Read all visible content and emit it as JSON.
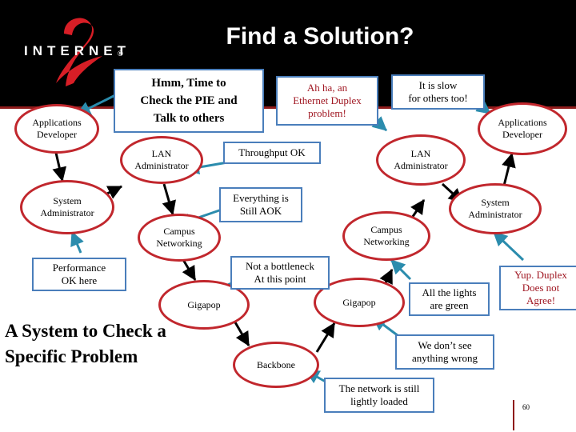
{
  "slide": {
    "title": "Find a Solution?",
    "bottom_heading": "A System to Check a Specific Problem",
    "page_number": "60",
    "logo": {
      "wordmark": "INTERNET",
      "numeral": "2",
      "registered": "®"
    },
    "colors": {
      "band": "#000000",
      "band_rule": "#8e1b1b",
      "title_text": "#ffffff",
      "node_border": "#c1272d",
      "box_border": "#4a7ebb",
      "callout_arrow": "#2b8cad",
      "flow_arrow": "#000000",
      "red_text": "#a01722"
    }
  },
  "nodes": [
    {
      "id": "left-app-dev",
      "label": "Applications\nDeveloper"
    },
    {
      "id": "left-lan-admin",
      "label": "LAN\nAdministrator"
    },
    {
      "id": "left-sys-admin",
      "label": "System\nAdministrator"
    },
    {
      "id": "left-campus",
      "label": "Campus\nNetworking"
    },
    {
      "id": "left-gigapop",
      "label": "Gigapop"
    },
    {
      "id": "backbone",
      "label": "Backbone"
    },
    {
      "id": "right-gigapop",
      "label": "Gigapop"
    },
    {
      "id": "right-campus",
      "label": "Campus\nNetworking"
    },
    {
      "id": "right-lan-admin",
      "label": "LAN\nAdministrator"
    },
    {
      "id": "right-sys-admin",
      "label": "System\nAdministrator"
    },
    {
      "id": "right-app-dev",
      "label": "Applications\nDeveloper"
    }
  ],
  "callouts": [
    {
      "id": "hmm",
      "text": "Hmm, Time to Check the PIE and Talk to others",
      "style": "big"
    },
    {
      "id": "ahha",
      "text": "Ah ha, an Ethernet Duplex problem!",
      "style": "red"
    },
    {
      "id": "slow-others",
      "text": "It is slow for others too!",
      "style": "plain"
    },
    {
      "id": "throughput-ok",
      "text": "Throughput OK",
      "style": "plain"
    },
    {
      "id": "everything-aok",
      "text": "Everything is Still AOK",
      "style": "plain"
    },
    {
      "id": "performance-ok",
      "text": "Performance OK here",
      "style": "plain"
    },
    {
      "id": "not-bottleneck",
      "text": "Not a bottleneck At this point",
      "style": "plain"
    },
    {
      "id": "lights-green",
      "text": "All the lights are green",
      "style": "plain"
    },
    {
      "id": "duplex-disagree",
      "text": "Yup. Duplex Does not Agree!",
      "style": "red"
    },
    {
      "id": "dont-see",
      "text": "We don’t see anything wrong",
      "style": "plain"
    },
    {
      "id": "lightly-loaded",
      "text": "The network is still lightly loaded",
      "style": "plain"
    }
  ]
}
